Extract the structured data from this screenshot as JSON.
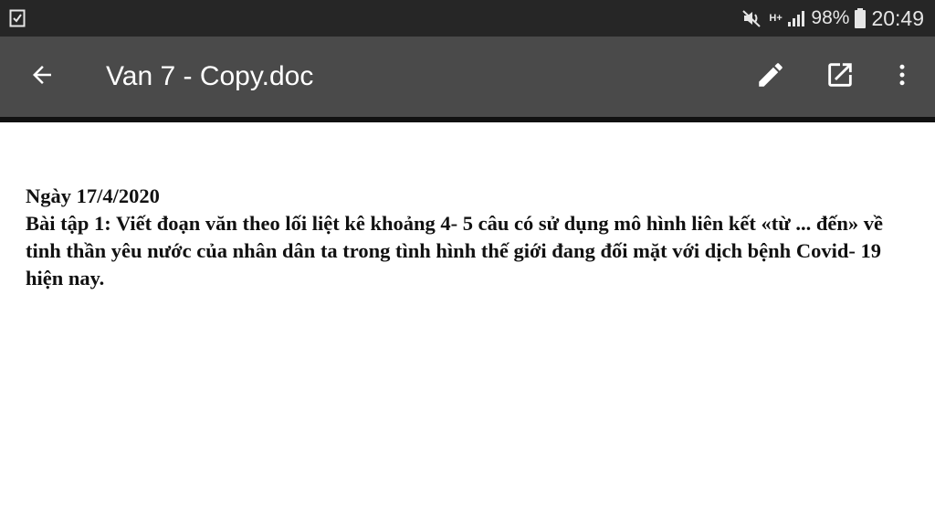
{
  "status_bar": {
    "notification_icon": "checklist-icon",
    "mute_icon": "vibrate-mute-icon",
    "network_label": "H+",
    "signal_icon": "signal-bars-icon",
    "battery_percent": "98%",
    "battery_icon": "battery-icon",
    "time": "20:49"
  },
  "app_bar": {
    "back_icon": "arrow-back-icon",
    "title": "Van 7 - Copy.doc",
    "edit_icon": "pencil-icon",
    "open_external_icon": "open-in-new-icon",
    "more_icon": "more-vert-icon"
  },
  "document": {
    "date_line": "Ngày 17/4/2020",
    "exercise_text": "Bài tập 1: Viết đoạn văn theo lối liệt kê khoảng 4- 5 câu có sử dụng mô hình liên kết «từ ... đến»  về tinh thần yêu nước của nhân dân ta  trong tình hình thế giới đang đối mặt với dịch bệnh Covid- 19 hiện nay."
  },
  "colors": {
    "status_bar_bg": "#262626",
    "app_bar_bg": "#4a4a4a",
    "document_bg": "#ffffff",
    "text": "#111111"
  }
}
